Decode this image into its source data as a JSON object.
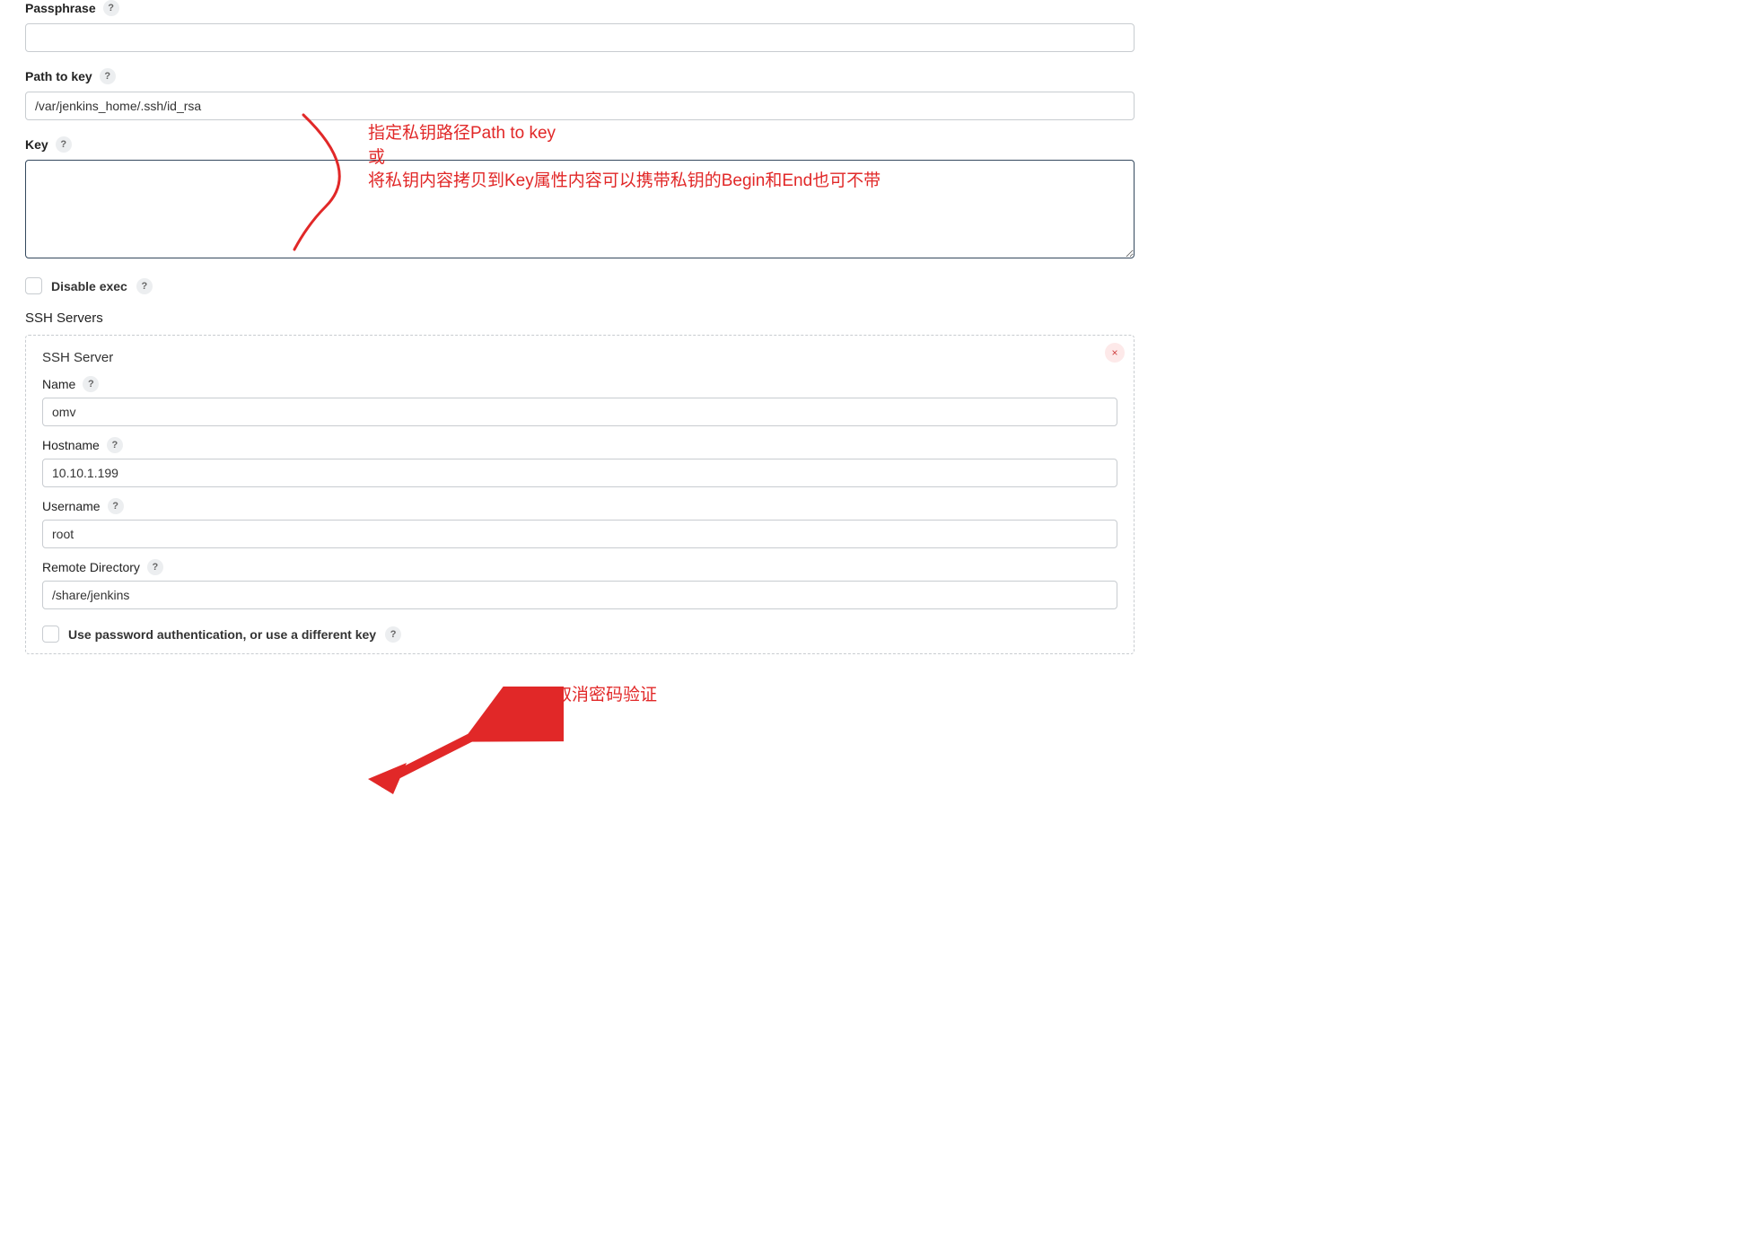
{
  "passphrase": {
    "label": "Passphrase",
    "value": ""
  },
  "pathToKey": {
    "label": "Path to key",
    "value": "/var/jenkins_home/.ssh/id_rsa"
  },
  "key": {
    "label": "Key",
    "value": ""
  },
  "disableExec": {
    "label": "Disable exec"
  },
  "sshServers": {
    "label": "SSH Servers"
  },
  "server": {
    "panelTitle": "SSH Server",
    "name": {
      "label": "Name",
      "value": "omv"
    },
    "hostname": {
      "label": "Hostname",
      "value": "10.10.1.199"
    },
    "username": {
      "label": "Username",
      "value": "root"
    },
    "remoteDir": {
      "label": "Remote Directory",
      "value": "/share/jenkins"
    },
    "usePassword": {
      "label": "Use password authentication, or use a different key"
    }
  },
  "helpGlyph": "?",
  "closeGlyph": "×",
  "annotation1": {
    "line1": "指定私钥路径Path to key",
    "line2": "或",
    "line3": "将私钥内容拷贝到Key属性内容可以携带私钥的Begin和End也可不带"
  },
  "annotation2": "取消密码验证"
}
